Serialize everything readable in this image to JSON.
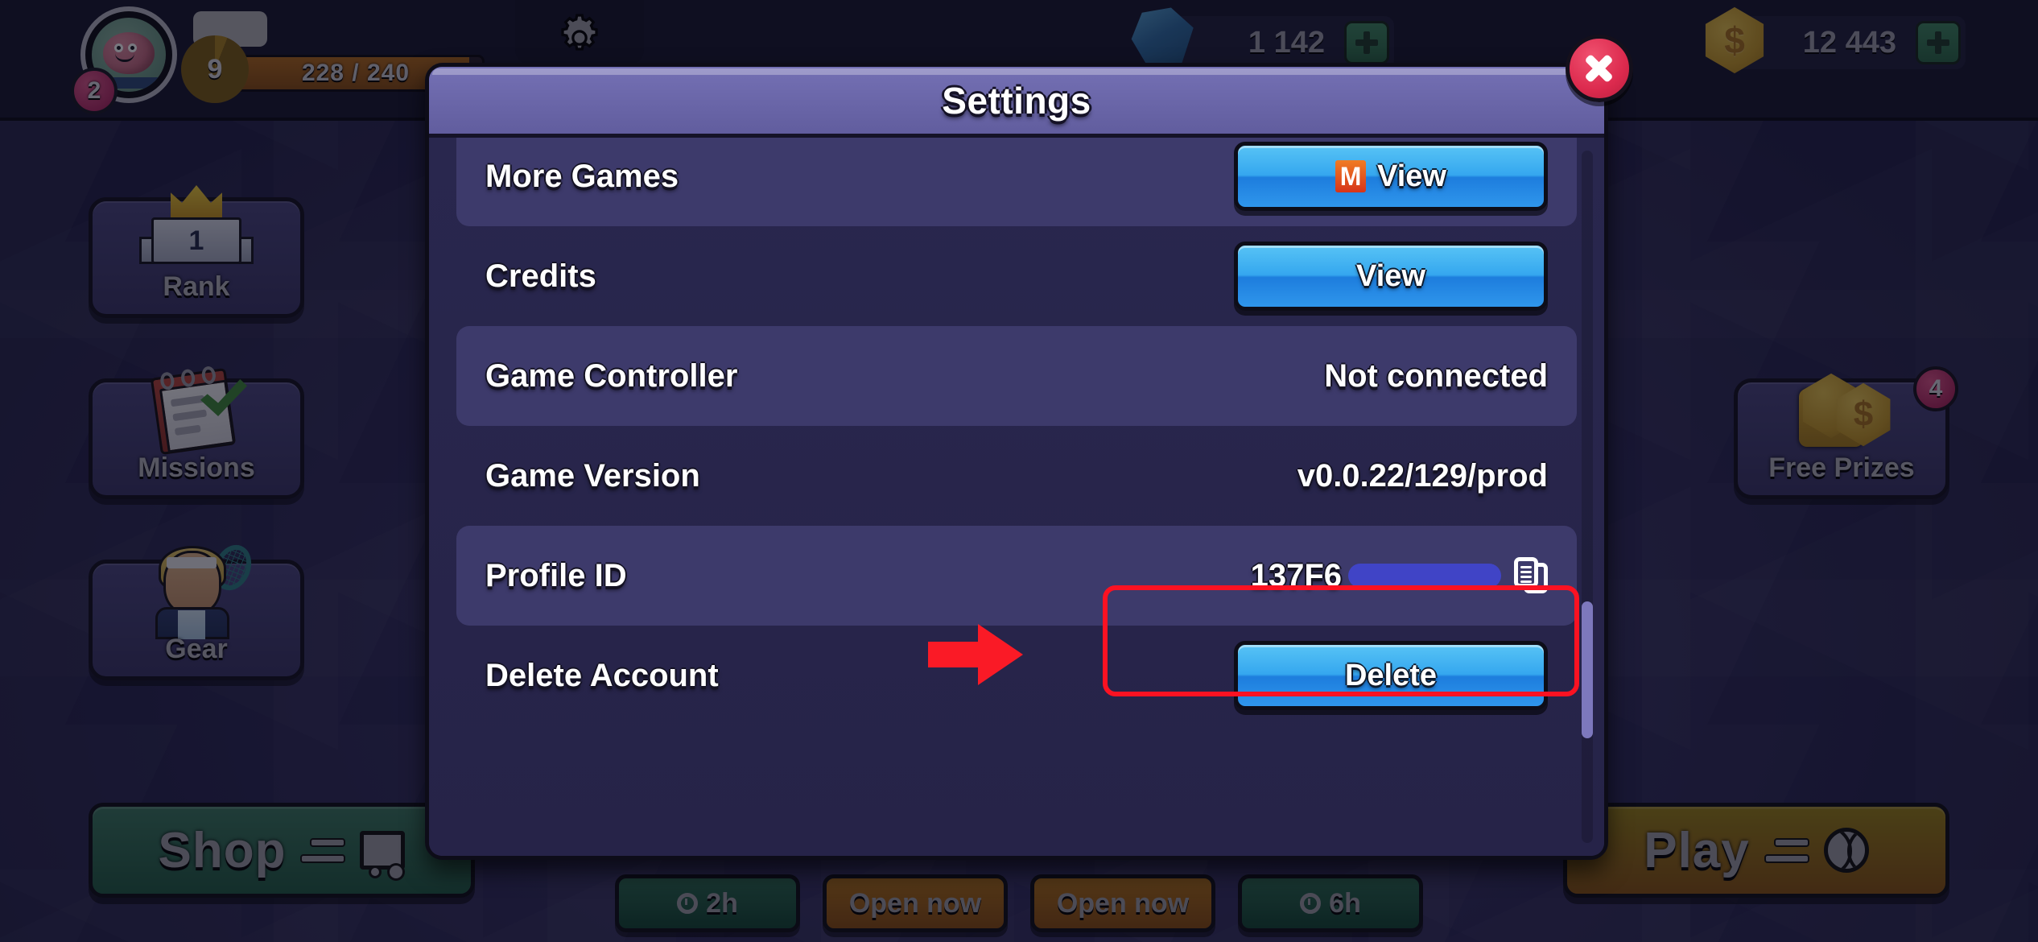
{
  "hud": {
    "player_level": "2",
    "xp_level": "9",
    "xp_progress": "228 / 240",
    "gems": {
      "icon": "gem-icon",
      "value": "1 142",
      "add_label": "+"
    },
    "coins": {
      "icon": "coin-icon",
      "value": "12 443",
      "add_label": "+"
    },
    "settings_icon": "gear-icon"
  },
  "nav": {
    "rank": {
      "label": "Rank",
      "icon": "podium-crown-icon",
      "position": "1"
    },
    "missions": {
      "label": "Missions",
      "icon": "clipboard-check-icon"
    },
    "gear": {
      "label": "Gear",
      "icon": "tennis-player-icon"
    },
    "free_prizes": {
      "label": "Free Prizes",
      "icon": "coin-stack-icon",
      "badge": "4"
    }
  },
  "bottom": {
    "shop": {
      "label": "Shop",
      "icon": "shopping-cart-icon"
    },
    "play": {
      "label": "Play",
      "icon": "tennis-ball-icon"
    },
    "chests": [
      {
        "label": "2h",
        "type": "timer",
        "icon": "clock-icon"
      },
      {
        "label": "Open now",
        "type": "open"
      },
      {
        "label": "Open now",
        "type": "open"
      },
      {
        "label": "6h",
        "type": "timer",
        "icon": "clock-icon"
      }
    ]
  },
  "modal": {
    "title": "Settings",
    "close_icon": "close-x-icon",
    "rows": [
      {
        "label": "More Games",
        "kind": "button",
        "button_label": "View",
        "button_icon": "miniclip-m-icon"
      },
      {
        "label": "Credits",
        "kind": "button",
        "button_label": "View"
      },
      {
        "label": "Game Controller",
        "kind": "value",
        "value": "Not connected"
      },
      {
        "label": "Game Version",
        "kind": "value",
        "value": "v0.0.22/129/prod"
      },
      {
        "label": "Profile ID",
        "kind": "profile",
        "value": "137F6",
        "redacted": true,
        "copy_icon": "copy-icon"
      },
      {
        "label": "Delete Account",
        "kind": "button",
        "button_label": "Delete"
      }
    ]
  },
  "annotations": {
    "arrow": {
      "color": "#fa1a26",
      "points_to": "profile-id-value"
    },
    "highlight_box": {
      "color": "#fb1222",
      "targets": "profile-id-value"
    }
  },
  "colors": {
    "modal_header": "#7470b4",
    "modal_body": "#29274e",
    "row_alt": "#3d3a6b",
    "blue_button": "#35a7ef",
    "annotation_red": "#fb1222",
    "redaction_blue": "#4044c6"
  }
}
